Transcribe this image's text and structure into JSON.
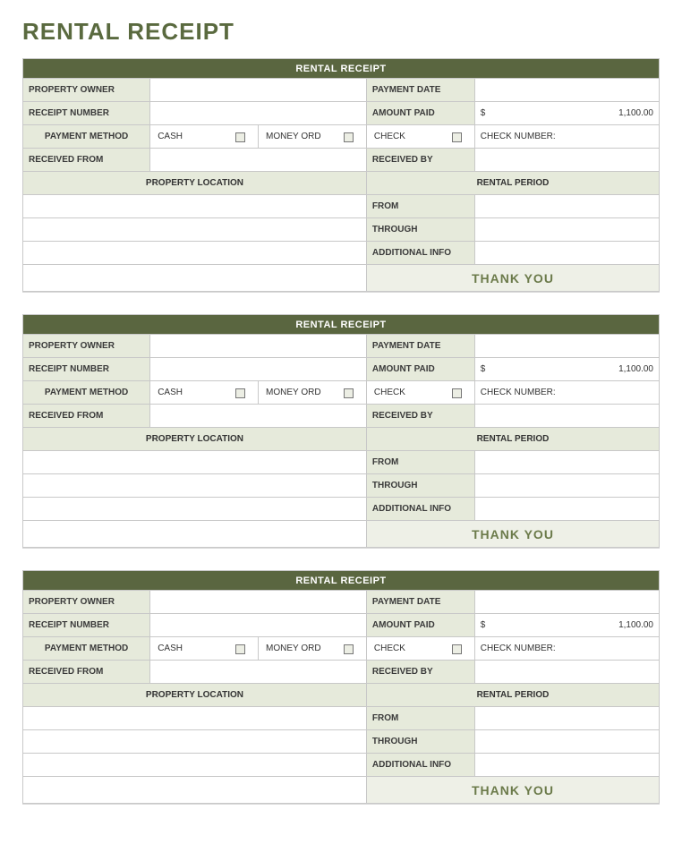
{
  "page_title": "RENTAL RECEIPT",
  "receipt": {
    "header": "RENTAL RECEIPT",
    "property_owner_label": "PROPERTY OWNER",
    "payment_date_label": "PAYMENT DATE",
    "receipt_number_label": "RECEIPT NUMBER",
    "amount_paid_label": "AMOUNT PAID",
    "currency_symbol": "$",
    "amount_paid_value": "1,100.00",
    "payment_method_label": "PAYMENT METHOD",
    "cash_label": "CASH",
    "money_order_label": "MONEY ORD",
    "check_label": "CHECK",
    "check_number_label": "CHECK NUMBER:",
    "received_from_label": "RECEIVED FROM",
    "received_by_label": "RECEIVED BY",
    "property_location_label": "PROPERTY LOCATION",
    "rental_period_label": "RENTAL PERIOD",
    "from_label": "FROM",
    "through_label": "THROUGH",
    "additional_info_label": "ADDITIONAL INFO",
    "thank_you": "THANK YOU"
  }
}
